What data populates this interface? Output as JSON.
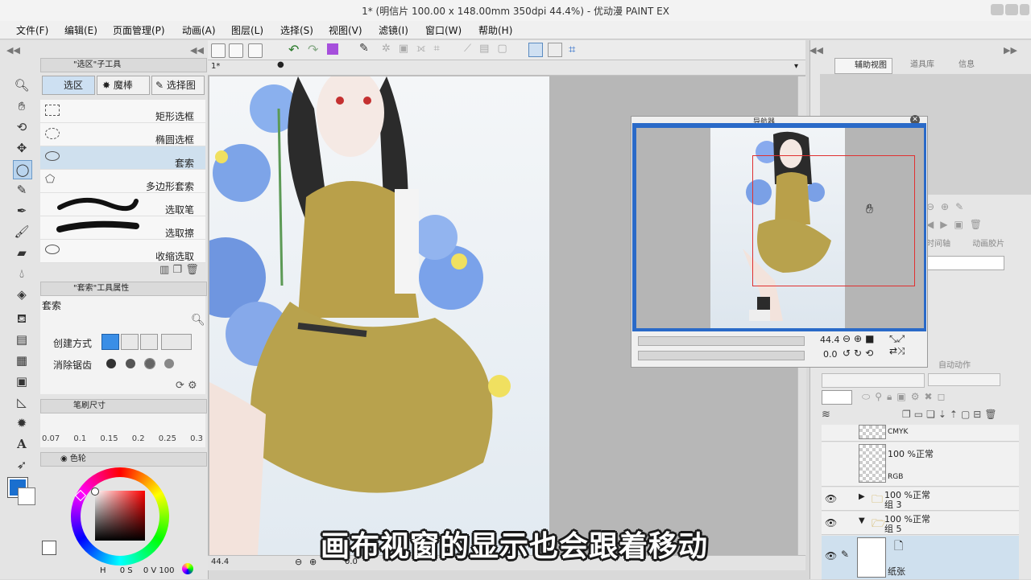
{
  "window": {
    "title": "1* (明信片 100.00 x 148.00mm 350dpi 44.4%) - 优动漫 PAINT EX"
  },
  "menu": [
    "文件(F)",
    "编辑(E)",
    "页面管理(P)",
    "动画(A)",
    "图层(L)",
    "选择(S)",
    "视图(V)",
    "滤镜(I)",
    "窗口(W)",
    "帮助(H)"
  ],
  "subtool_panel": {
    "header": "\"选区\"子工具",
    "tabs": [
      "选区",
      "魔棒",
      "选择图"
    ],
    "items": [
      "矩形选框",
      "椭圆选框",
      "套索",
      "多边形套索",
      "选取笔",
      "选取擦",
      "收缩选取"
    ],
    "active_index": 2
  },
  "tool_property": {
    "header": "\"套索\"工具属性",
    "name": "套索",
    "create_mode_label": "创建方式",
    "antialias_label": "消除锯齿"
  },
  "brush_size": {
    "header": "笔刷尺寸",
    "values": [
      "0.07",
      "0.1",
      "0.15",
      "0.2",
      "0.25",
      "0.3"
    ]
  },
  "color": {
    "tab_label": "色轮",
    "h": "0",
    "s": "0",
    "v": "100",
    "s_label": "S",
    "v_label": "V",
    "h_label": "H",
    "accent": "#7e57e5"
  },
  "canvas": {
    "tab": "1*",
    "zoom": "44.4",
    "angle": "0.0"
  },
  "navigator": {
    "title": "导航器",
    "zoom": "44.4",
    "angle": "0.0"
  },
  "right_panel": {
    "tabs": [
      "辅助视图",
      "道具库",
      "信息"
    ],
    "layer_tabs": [
      "时间轴",
      "动画胶片"
    ],
    "auto_action": "自动动作"
  },
  "layers": [
    {
      "mode": "CMYK",
      "name": ""
    },
    {
      "mode": "100 %正常",
      "name": "RGB"
    },
    {
      "mode": "100 %正常",
      "name": "组 3"
    },
    {
      "mode": "100 %正常",
      "name": "组 5"
    },
    {
      "mode": "",
      "name": "纸张"
    }
  ],
  "subtitle": "画布视窗的显示也会跟着移动"
}
